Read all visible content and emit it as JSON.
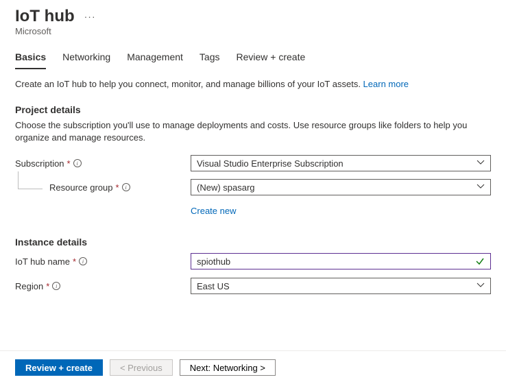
{
  "header": {
    "title": "IoT hub",
    "subtitle": "Microsoft"
  },
  "tabs": {
    "basics": "Basics",
    "networking": "Networking",
    "management": "Management",
    "tags": "Tags",
    "review": "Review + create"
  },
  "intro": {
    "text": "Create an IoT hub to help you connect, monitor, and manage billions of your IoT assets.  ",
    "learn_more": "Learn more"
  },
  "project": {
    "title": "Project details",
    "desc": "Choose the subscription you'll use to manage deployments and costs. Use resource groups like folders to help you organize and manage resources.",
    "subscription_label": "Subscription",
    "subscription_value": "Visual Studio Enterprise Subscription",
    "rg_label": "Resource group",
    "rg_value": "(New) spasarg",
    "create_new": "Create new"
  },
  "instance": {
    "title": "Instance details",
    "name_label": "IoT hub name",
    "name_value": "spiothub",
    "region_label": "Region",
    "region_value": "East US"
  },
  "footer": {
    "review": "Review + create",
    "previous": "< Previous",
    "next": "Next: Networking >"
  }
}
